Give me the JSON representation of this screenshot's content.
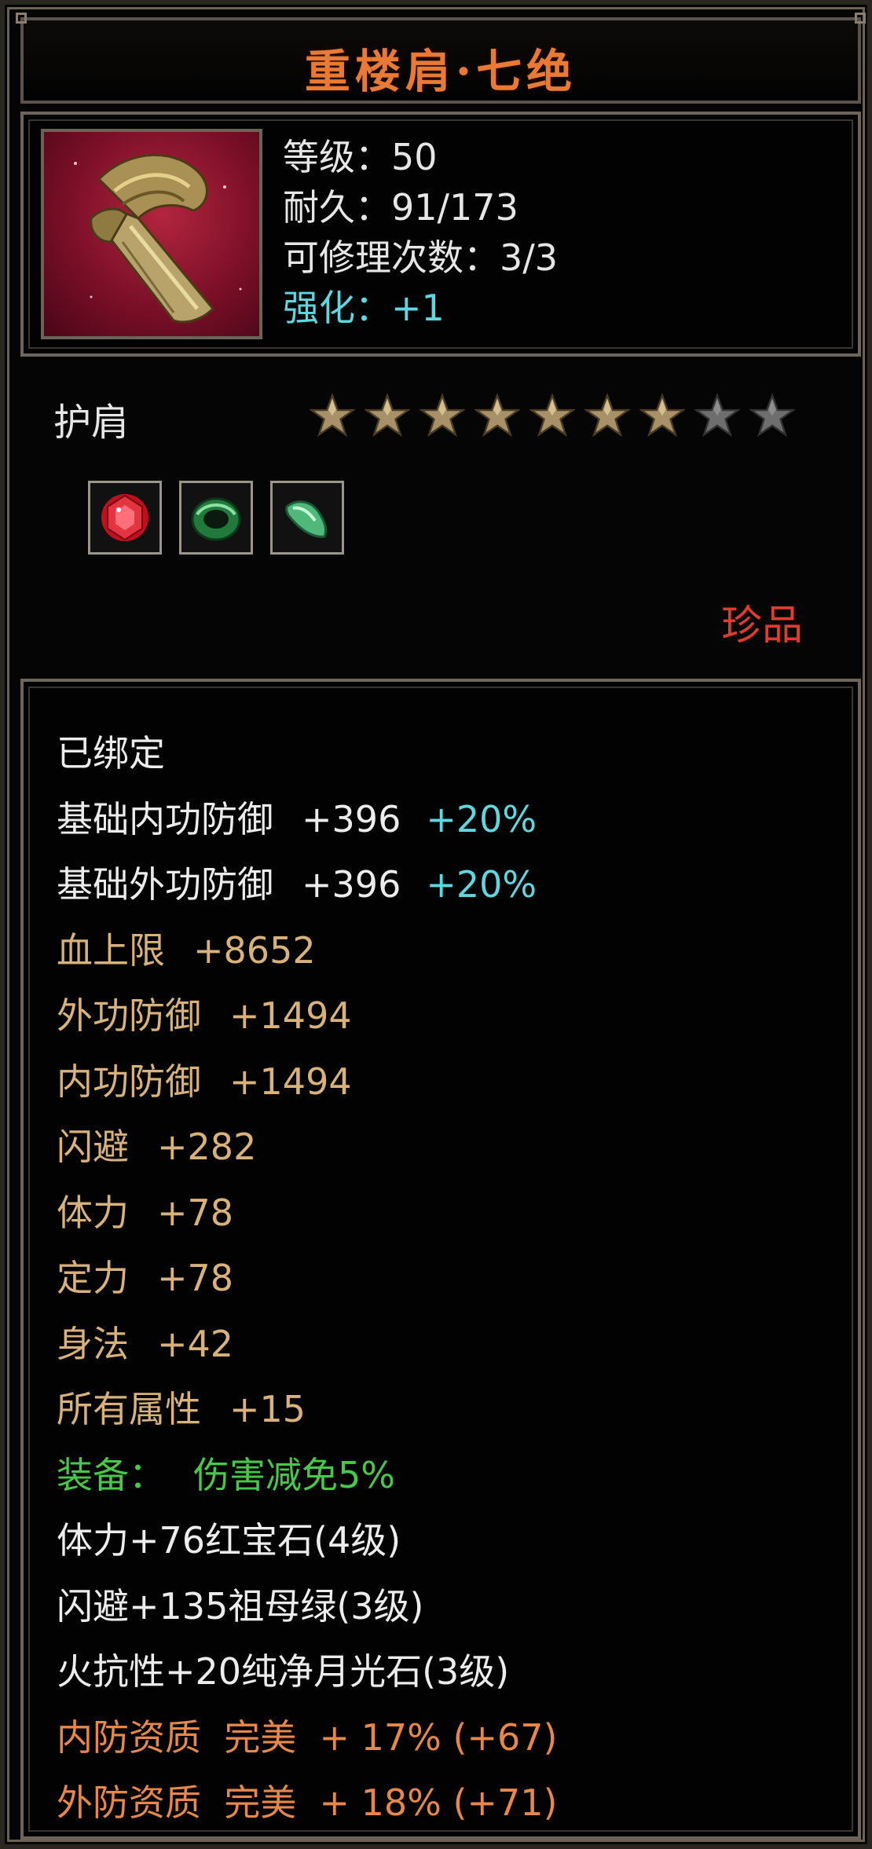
{
  "item": {
    "name": "重楼肩·七绝",
    "type": "护肩",
    "rarity": "珍品",
    "icon": "shoulder-armor-icon"
  },
  "info": {
    "level": "等级：50",
    "durability": "耐久：91/173",
    "repairs": "可修理次数：3/3",
    "enhance": "强化：+1"
  },
  "stars": {
    "filled": 7,
    "total": 9,
    "filled_color": "#a89068",
    "empty_color": "#6e6e6e"
  },
  "gems": [
    {
      "icon": "red-gem-icon"
    },
    {
      "icon": "green-gem-icon"
    },
    {
      "icon": "moonstone-gem-icon"
    }
  ],
  "attributes": {
    "bound": "已绑定",
    "base_inner_def": {
      "label": "基础内功防御",
      "value": "+396",
      "extra": "+20%"
    },
    "base_outer_def": {
      "label": "基础外功防御",
      "value": "+396",
      "extra": "+20%"
    },
    "hp": {
      "label": "血上限",
      "value": "+8652"
    },
    "outer_def": {
      "label": "外功防御",
      "value": "+1494"
    },
    "inner_def": {
      "label": "内功防御",
      "value": "+1494"
    },
    "dodge": {
      "label": "闪避",
      "value": "+282"
    },
    "stamina": {
      "label": "体力",
      "value": "+78"
    },
    "focus": {
      "label": "定力",
      "value": "+78"
    },
    "agility": {
      "label": "身法",
      "value": "+42"
    },
    "all": {
      "label": "所有属性",
      "value": "+15"
    },
    "equip_effect": {
      "label": "装备：",
      "value": "伤害减免5%"
    },
    "gem_lines": [
      "体力+76红宝石(4级)",
      "闪避+135祖母绿(3级)",
      "火抗性+20纯净月光石(3级)"
    ],
    "quality_lines": [
      "内防资质  完美  + 17% (+67)",
      "外防资质  完美  + 18% (+71)"
    ]
  },
  "colors": {
    "title": "#e97a36",
    "gold_text": "#d8b27a",
    "cyan_text": "#5fd7e0",
    "green_text": "#48c84a",
    "orange_text": "#e7884a",
    "rarity_red": "#e13b2f"
  }
}
